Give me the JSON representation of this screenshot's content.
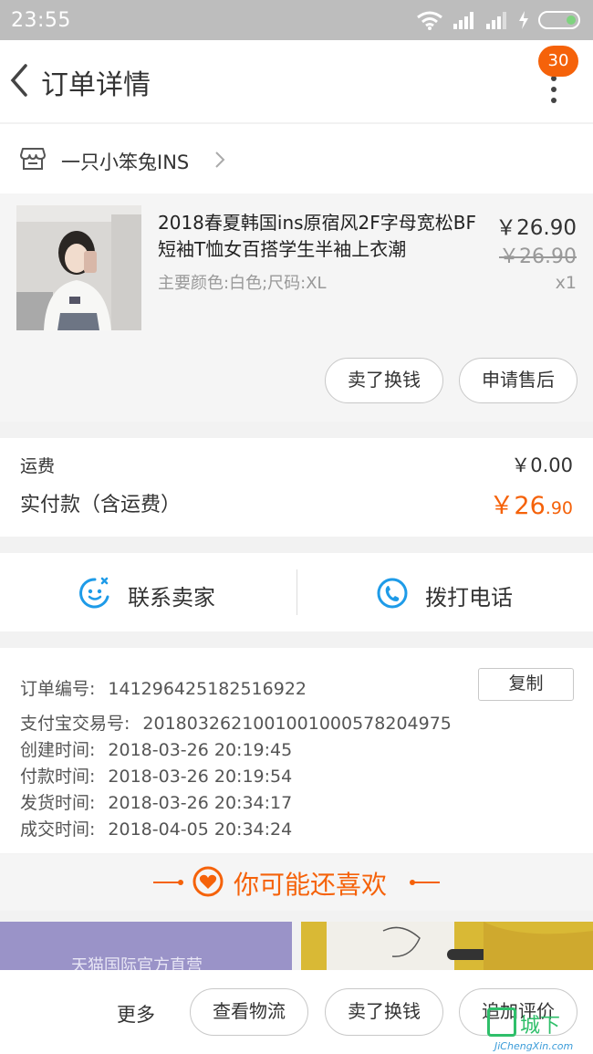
{
  "status_bar": {
    "time": "23:55"
  },
  "header": {
    "title": "订单详情",
    "badge_count": "30"
  },
  "shop": {
    "name": "一只小笨兔INS"
  },
  "product": {
    "title": "2018春夏韩国ins原宿风2F字母宽松BF短袖T恤女百搭学生半袖上衣潮",
    "sku": "主要颜色:白色;尺码:XL",
    "price": "￥26.90",
    "original_price": "￥26.90",
    "quantity": "x1",
    "btn_sell": "卖了换钱",
    "btn_after_sale": "申请售后"
  },
  "fees": {
    "shipping_label": "运费",
    "shipping_value": "￥0.00",
    "paid_label": "实付款（含运费）",
    "paid_main": "￥26",
    "paid_cents": ".90"
  },
  "contact": {
    "seller_label": "联系卖家",
    "phone_label": "拨打电话"
  },
  "order_info": {
    "copy_label": "复制",
    "rows": [
      {
        "key": "订单编号:",
        "value": "141296425182516922"
      },
      {
        "key": "支付宝交易号:",
        "value": "2018032621001001000578204975"
      },
      {
        "key": "创建时间:",
        "value": "2018-03-26 20:19:45"
      },
      {
        "key": "付款时间:",
        "value": "2018-03-26 20:19:54"
      },
      {
        "key": "发货时间:",
        "value": "2018-03-26 20:34:17"
      },
      {
        "key": "成交时间:",
        "value": "2018-04-05 20:34:24"
      }
    ]
  },
  "recommend": {
    "title": "你可能还喜欢",
    "banner_text": "天猫国际官方直营"
  },
  "bottom_bar": {
    "more_label": "更多",
    "btn_logistics": "查看物流",
    "btn_sell": "卖了换钱",
    "btn_review": "追加评价"
  },
  "watermark": {
    "cn": "城下",
    "en": "JiChengXin.com"
  },
  "colors": {
    "accent": "#f5620a",
    "icon_blue": "#1e9be8",
    "status_bar": "#bdbdbd"
  }
}
